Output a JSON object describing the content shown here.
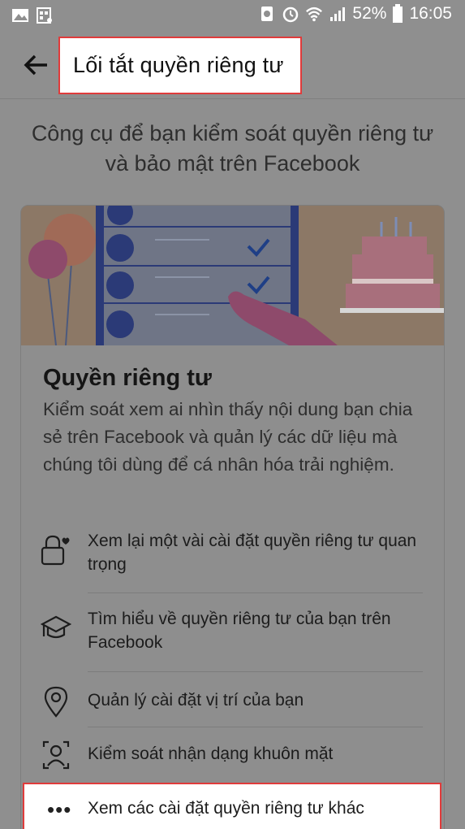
{
  "status_bar": {
    "battery_percent": "52%",
    "time": "16:05"
  },
  "header": {
    "back_icon": "back-arrow-icon",
    "title": "Lối tắt quyền riêng tư"
  },
  "subtitle": "Công cụ để bạn kiểm soát quyền riêng tư và bảo mật trên Facebook",
  "card": {
    "title": "Quyền riêng tư",
    "description": "Kiểm soát xem ai nhìn thấy nội dung bạn chia sẻ trên Facebook và quản lý các dữ liệu mà chúng tôi dùng để cá nhân hóa trải nghiệm.",
    "items": [
      {
        "icon": "lock-heart-icon",
        "label": "Xem lại một vài cài đặt quyền riêng tư quan trọng"
      },
      {
        "icon": "graduation-cap-icon",
        "label": "Tìm hiểu về quyền riêng tư của bạn trên Facebook"
      },
      {
        "icon": "location-pin-icon",
        "label": "Quản lý cài đặt vị trí của bạn"
      },
      {
        "icon": "face-scan-icon",
        "label": "Kiểm soát nhận dạng khuôn mặt"
      }
    ],
    "more": {
      "icon": "more-dots-icon",
      "dots": "•••",
      "label": "Xem các cài đặt quyền riêng tư khác"
    }
  },
  "colors": {
    "overlay_gray": "#8f8f8f",
    "highlight_border": "#e03b3b",
    "checkmark_blue": "#1f3f86"
  }
}
